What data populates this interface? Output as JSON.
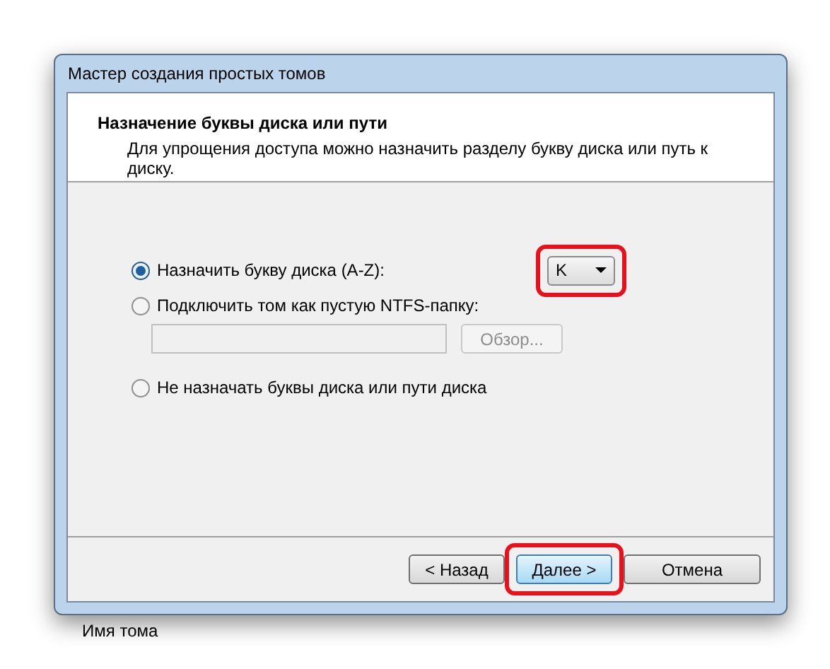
{
  "window": {
    "title": "Мастер создания простых томов"
  },
  "header": {
    "title": "Назначение буквы диска или пути",
    "description": "Для упрощения доступа можно назначить разделу букву диска или путь к диску."
  },
  "options": [
    {
      "kind": "letter",
      "label": "Назначить букву диска (A-Z):",
      "selected": true,
      "dropdown": {
        "value": "K",
        "highlighted": true
      }
    },
    {
      "kind": "folder",
      "label": "Подключить том как пустую NTFS-папку:",
      "selected": false,
      "browse_button": {
        "label": "Обзор...",
        "disabled": true
      }
    },
    {
      "kind": "none",
      "label": "Не назначать буквы диска или пути диска",
      "selected": false
    }
  ],
  "buttons": [
    {
      "label": "< Назад",
      "default": false,
      "highlighted": false
    },
    {
      "label": "Далее >",
      "default": true,
      "highlighted": true
    },
    {
      "label": "Отмена",
      "default": false,
      "highlighted": false
    }
  ],
  "background_text": "Имя тома"
}
